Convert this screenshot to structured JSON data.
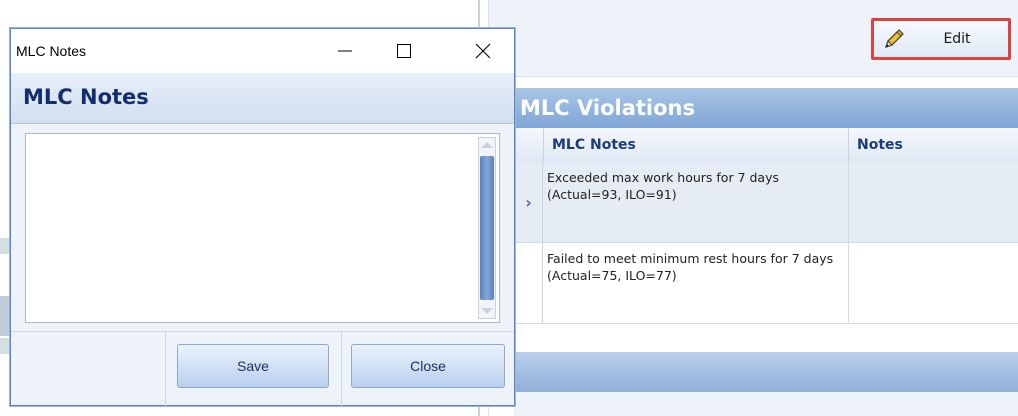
{
  "main": {
    "edit_button_label": "Edit",
    "violations_title": "MLC Violations",
    "grid": {
      "columns": [
        "MLC Notes",
        "Notes"
      ],
      "rows": [
        {
          "indicator": "›",
          "mlc_notes": "Exceeded max work hours for 7 days (Actual=93, ILO=91)",
          "notes": ""
        },
        {
          "indicator": "",
          "mlc_notes": "Failed to meet minimum rest hours for 7 days (Actual=75, ILO=77)",
          "notes": ""
        }
      ]
    }
  },
  "dialog": {
    "window_title": "MLC Notes",
    "header": "MLC Notes",
    "textarea_value": "",
    "save_label": "Save",
    "close_label": "Close"
  },
  "colors": {
    "accent": "#7fa6d6",
    "highlight_border": "#e04040",
    "header_text": "#142d6e"
  },
  "icons": {
    "edit": "pencil-icon",
    "minimize": "minimize-icon",
    "maximize": "maximize-icon",
    "close": "close-icon",
    "row_indicator": "chevron-right-icon"
  }
}
